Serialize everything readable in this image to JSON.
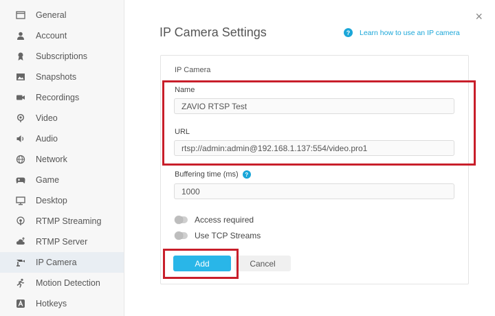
{
  "sidebar": {
    "items": [
      {
        "label": "General",
        "icon": "window-icon"
      },
      {
        "label": "Account",
        "icon": "person-icon"
      },
      {
        "label": "Subscriptions",
        "icon": "ribbon-icon"
      },
      {
        "label": "Snapshots",
        "icon": "image-icon"
      },
      {
        "label": "Recordings",
        "icon": "videocam-icon"
      },
      {
        "label": "Video",
        "icon": "location-icon"
      },
      {
        "label": "Audio",
        "icon": "speaker-icon"
      },
      {
        "label": "Network",
        "icon": "globe-icon"
      },
      {
        "label": "Game",
        "icon": "gamepad-icon"
      },
      {
        "label": "Desktop",
        "icon": "monitor-icon"
      },
      {
        "label": "RTMP Streaming",
        "icon": "broadcast-icon"
      },
      {
        "label": "RTMP Server",
        "icon": "cloud-upload-icon"
      },
      {
        "label": "IP Camera",
        "icon": "camera-icon"
      },
      {
        "label": "Motion Detection",
        "icon": "running-person-icon"
      },
      {
        "label": "Hotkeys",
        "icon": "key-a-icon"
      }
    ],
    "active": "IP Camera"
  },
  "header": {
    "title": "IP Camera Settings",
    "help_link": "Learn how to use an IP camera",
    "help_icon": "?",
    "close": "×"
  },
  "form": {
    "section_title": "IP Camera",
    "name_label": "Name",
    "name_value": "ZAVIO RTSP Test",
    "url_label": "URL",
    "url_value": "rtsp://admin:admin@192.168.1.137:554/video.pro1",
    "buffering_label": "Buffering time (ms)",
    "buffering_help": "?",
    "buffering_value": "1000",
    "access_required_label": "Access required",
    "tcp_streams_label": "Use TCP Streams",
    "add_label": "Add",
    "cancel_label": "Cancel"
  },
  "colors": {
    "accent": "#29b6e8",
    "highlight": "#c81e2a",
    "active_bg": "#e9eef3"
  }
}
